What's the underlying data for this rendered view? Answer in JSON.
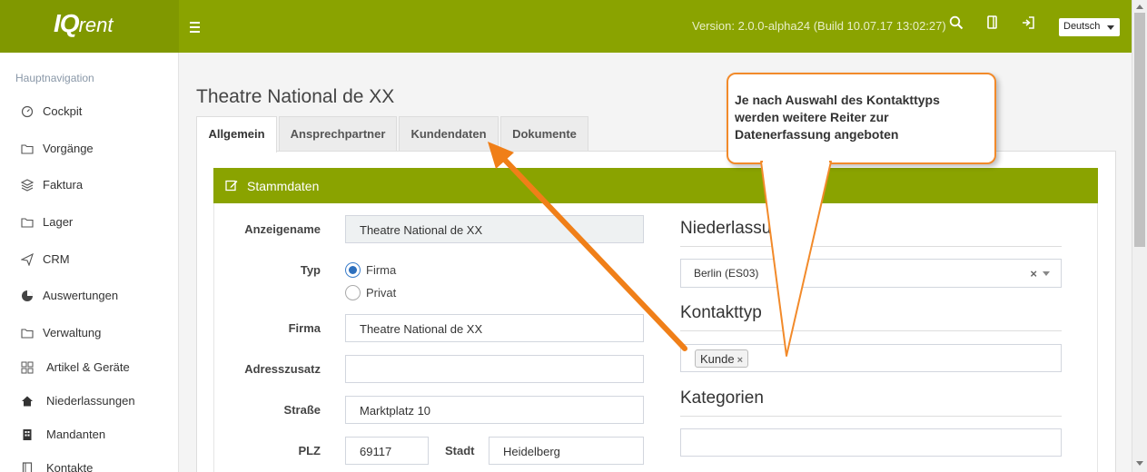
{
  "header": {
    "logo_iq": "IQ",
    "logo_rent": "rent",
    "version": "Version: 2.0.0-alpha24 (Build 10.07.17 13:02:27)",
    "language": "Deutsch",
    "accent_color": "#8aa300"
  },
  "sidebar": {
    "title": "Hauptnavigation",
    "items": [
      {
        "label": "Cockpit",
        "icon": "dashboard-icon"
      },
      {
        "label": "Vorgänge",
        "icon": "folder-icon"
      },
      {
        "label": "Faktura",
        "icon": "layers-icon"
      },
      {
        "label": "Lager",
        "icon": "folder-icon"
      },
      {
        "label": "CRM",
        "icon": "send-icon"
      },
      {
        "label": "Auswertungen",
        "icon": "pie-chart-icon"
      },
      {
        "label": "Verwaltung",
        "icon": "folder-icon"
      },
      {
        "label": "Artikel & Geräte",
        "icon": "grid-icon"
      },
      {
        "label": "Niederlassungen",
        "icon": "home-icon"
      },
      {
        "label": "Mandanten",
        "icon": "building-icon"
      },
      {
        "label": "Kontakte",
        "icon": "book-icon"
      }
    ]
  },
  "main": {
    "title": "Theatre National de XX",
    "tabs": [
      {
        "label": "Allgemein",
        "active": true
      },
      {
        "label": "Ansprechpartner",
        "active": false
      },
      {
        "label": "Kundendaten",
        "active": false
      },
      {
        "label": "Dokumente",
        "active": false
      }
    ],
    "box_title": "Stammdaten",
    "form": {
      "anzeigename_label": "Anzeigename",
      "anzeigename_value": "Theatre National de XX",
      "typ_label": "Typ",
      "typ_options": [
        "Firma",
        "Privat"
      ],
      "typ_selected": "Firma",
      "firma_label": "Firma",
      "firma_value": "Theatre National de XX",
      "adresszusatz_label": "Adresszusatz",
      "adresszusatz_value": "",
      "strasse_label": "Straße",
      "strasse_value": "Marktplatz 10",
      "plz_label": "PLZ",
      "plz_value": "69117",
      "stadt_label": "Stadt",
      "stadt_value": "Heidelberg"
    },
    "right": {
      "niederlassung_heading": "Niederlassu",
      "niederlassung_value": "Berlin (ES03)",
      "kontakttyp_heading": "Kontakttyp",
      "kontakttyp_tags": [
        "Kunde"
      ],
      "kategorien_heading": "Kategorien"
    }
  },
  "callout": {
    "text": "Je nach Auswahl des Kontakttyps werden weitere Reiter zur Datenerfassung angeboten",
    "border_color": "#f28a2a"
  }
}
